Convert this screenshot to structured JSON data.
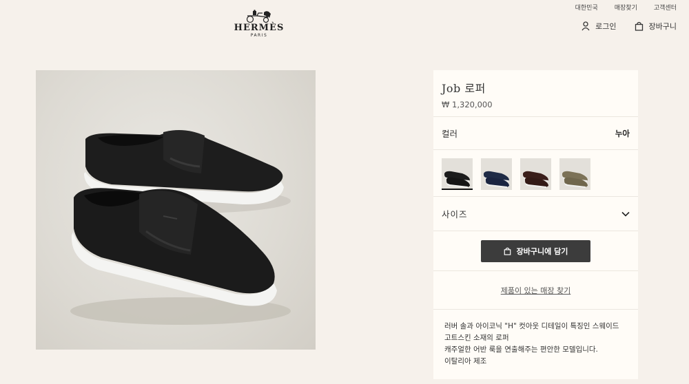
{
  "utility_nav": [
    "대한민국",
    "매장찾기",
    "고객센터"
  ],
  "logo": {
    "brand": "HERMÈS",
    "city": "PARIS"
  },
  "header_actions": {
    "login": {
      "label": "로그인",
      "icon": "user-icon"
    },
    "cart": {
      "label": "장바구니",
      "icon": "bag-icon"
    }
  },
  "product": {
    "name": "Job 로퍼",
    "price": "₩ 1,320,000",
    "color_label": "컬러",
    "color_value": "누아",
    "swatches": [
      {
        "color": "#1c1c1c",
        "selected": true
      },
      {
        "color": "#1f2b46",
        "selected": false
      },
      {
        "color": "#3a1e1a",
        "selected": false
      },
      {
        "color": "#7c7257",
        "selected": false
      }
    ],
    "size_label": "사이즈",
    "add_to_cart": "장바구니에 담기",
    "store_link": "제품이 있는 매장 찾기",
    "description": [
      "러버 솔과 아이코닉 \"H\" 컷아웃 디테일이 특징인 스웨이드 고트스킨 소재의 로퍼",
      "캐주얼한 어반 룩을 연출해주는 편안한 모델입니다.",
      "이탈리아 제조"
    ]
  },
  "colors": {
    "background": "#f6f1eb",
    "panel": "#fffcf7",
    "button": "#3c3c3c"
  }
}
